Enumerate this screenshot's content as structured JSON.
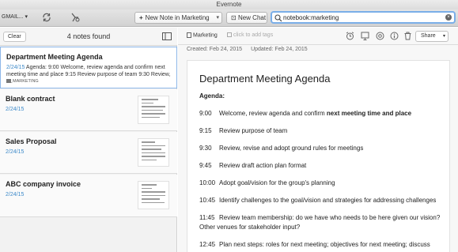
{
  "window": {
    "title": "Evernote"
  },
  "toolbar": {
    "account": "GMAIL... ▾",
    "new_note_label": "New Note in Marketing",
    "new_chat_label": "New Chat",
    "search_value": "notebook:marketing"
  },
  "note_list": {
    "clear_label": "Clear",
    "count_label": "4 notes found",
    "notes": [
      {
        "title": "Department Meeting Agenda",
        "date": "2/24/15",
        "snippet_1": "  Agenda: 9:00 Welcome, review agenda and confirm next",
        "snippet_2": "meeting time and place 9:15 Review purpose of team 9:30 Review, r...",
        "tag": "MARKETING"
      },
      {
        "title": "Blank contract",
        "date": "2/24/15"
      },
      {
        "title": "Sales Proposal",
        "date": "2/24/15"
      },
      {
        "title": "ABC company invoice",
        "date": "2/24/15"
      }
    ]
  },
  "editor": {
    "notebook": "Marketing",
    "tags_placeholder": "click to add tags",
    "share_label": "Share",
    "created": "Created: Feb 24, 2015",
    "updated": "Updated: Feb 24, 2015",
    "doc_title": "Department Meeting Agenda",
    "agenda_label": "Agenda:",
    "items": [
      {
        "time": "9:00",
        "text": "Welcome, review agenda and confirm ",
        "bold": "next meeting time and place"
      },
      {
        "time": "9:15",
        "text": "Review purpose of team"
      },
      {
        "time": "9:30",
        "text": "Review, revise and adopt ground rules for meetings"
      },
      {
        "time": "9:45",
        "text": "Review draft action plan format"
      },
      {
        "time": "10:00",
        "text": "Adopt goal/vision for the group's planning"
      },
      {
        "time": "10:45",
        "text": "Identify challenges to the goal/vision and strategies for addressing challenges"
      },
      {
        "time": "11:45",
        "text": "Review team membership: do we have who needs to be here given our vision?",
        "line2": "Other venues for stakeholder input?"
      },
      {
        "time": "12:45",
        "text": "Plan next steps: roles for next meeting;  objectives for next meeting; discuss"
      }
    ]
  },
  "colors": {
    "accent": "#3c89c9",
    "search_focus": "#7aaee8",
    "selected_border": "#8db7e8"
  },
  "icons": [
    "sync-icon",
    "activity-icon",
    "search-icon",
    "clear-search-icon",
    "view-options-icon",
    "notebook-icon",
    "tag-icon",
    "reminder-icon",
    "present-icon",
    "shortcut-icon",
    "info-icon",
    "trash-icon"
  ]
}
